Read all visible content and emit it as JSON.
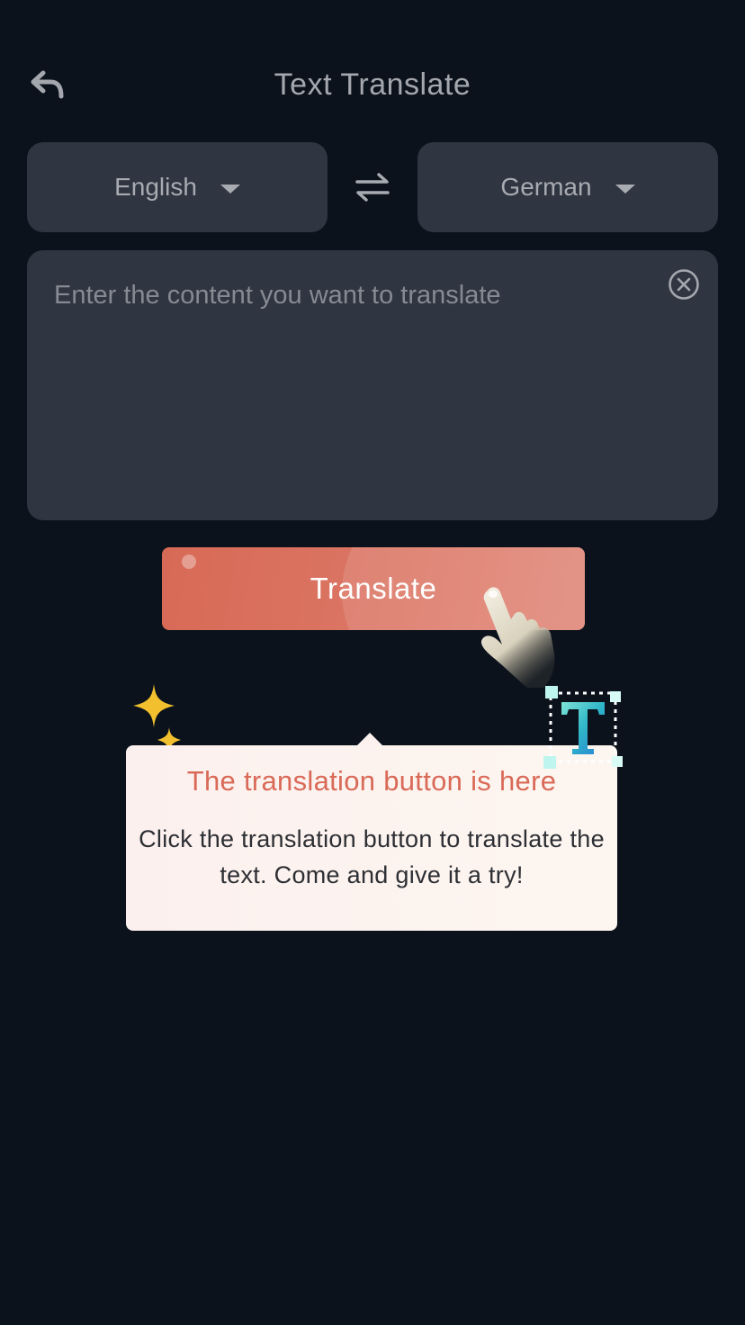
{
  "header": {
    "title": "Text Translate",
    "back_icon": "back-arrow-icon"
  },
  "languages": {
    "source": "English",
    "target": "German",
    "dropdown_icon": "caret-down-icon",
    "swap_icon": "swap-arrows-icon"
  },
  "input": {
    "placeholder": "Enter the content you want to translate",
    "value": "",
    "clear_icon": "clear-circle-icon"
  },
  "translate_button": {
    "label": "Translate"
  },
  "tooltip": {
    "title": "The translation button is here",
    "body": "Click the translation button to translate the text. Come and give it a try!",
    "decorations": [
      "pointing-hand-icon",
      "sparkle-icon",
      "text-t-icon"
    ]
  },
  "colors": {
    "background": "#0b121c",
    "panel": "#2f3541",
    "accent": "#d96a58",
    "tooltip_bg": "#fcf0ee"
  }
}
